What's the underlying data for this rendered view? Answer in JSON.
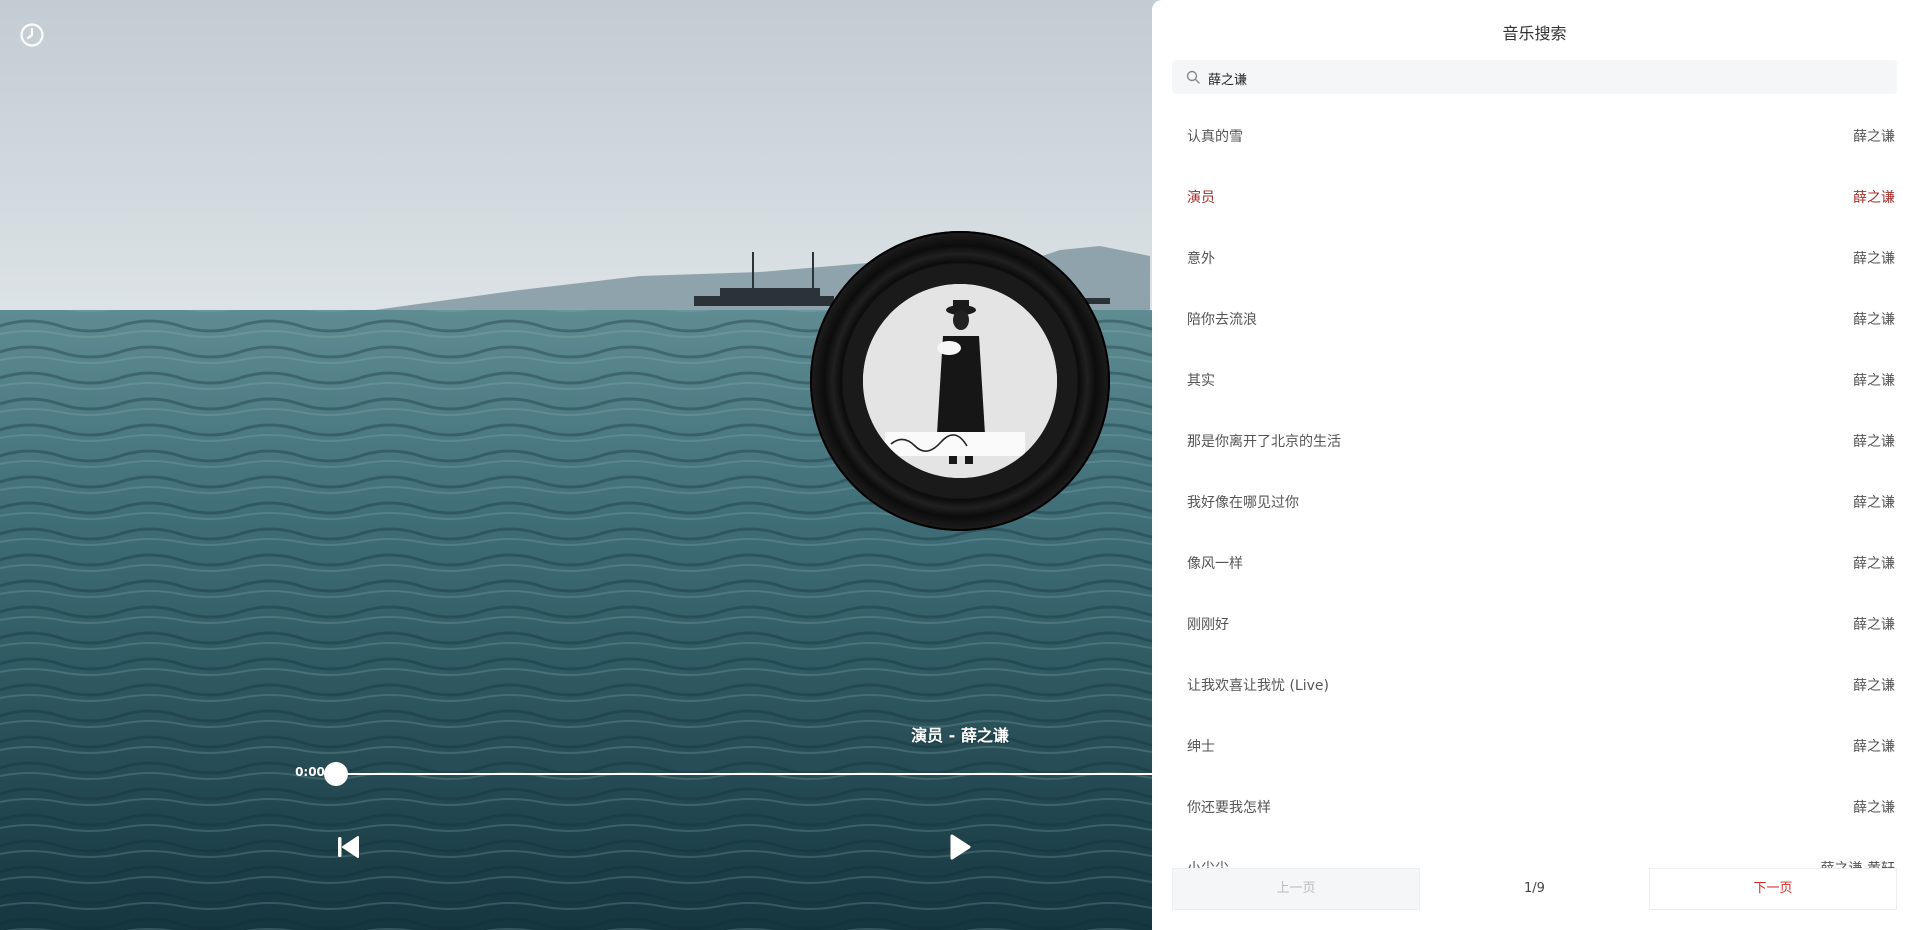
{
  "player": {
    "now_playing": "演员 - 薛之谦",
    "current_time": "0:00",
    "progress": 0
  },
  "icons": {
    "history": "history-clock-icon",
    "prev": "skip-previous-icon",
    "play": "play-icon",
    "search": "search-icon"
  },
  "search_panel": {
    "title": "音乐搜索",
    "query": "薛之谦",
    "results": [
      {
        "title": "认真的雪",
        "artist": "薛之谦",
        "active": false
      },
      {
        "title": "演员",
        "artist": "薛之谦",
        "active": true
      },
      {
        "title": "意外",
        "artist": "薛之谦",
        "active": false
      },
      {
        "title": "陪你去流浪",
        "artist": "薛之谦",
        "active": false
      },
      {
        "title": "其实",
        "artist": "薛之谦",
        "active": false
      },
      {
        "title": "那是你离开了北京的生活",
        "artist": "薛之谦",
        "active": false
      },
      {
        "title": "我好像在哪见过你",
        "artist": "薛之谦",
        "active": false
      },
      {
        "title": "像风一样",
        "artist": "薛之谦",
        "active": false
      },
      {
        "title": "刚刚好",
        "artist": "薛之谦",
        "active": false
      },
      {
        "title": "让我欢喜让我忧 (Live)",
        "artist": "薛之谦",
        "active": false
      },
      {
        "title": "绅士",
        "artist": "薛之谦",
        "active": false
      },
      {
        "title": "你还要我怎样",
        "artist": "薛之谦",
        "active": false
      },
      {
        "title": "小尖尖",
        "artist": "薛之谦 黄轩",
        "active": false
      }
    ],
    "pager": {
      "prev_label": "上一页",
      "page": "1/9",
      "next_label": "下一页"
    }
  },
  "colors": {
    "active_song": "#a3302b",
    "next_page": "#d42a2a",
    "sea_dark": "#1f4a52",
    "sky": "#c9d2d8"
  }
}
